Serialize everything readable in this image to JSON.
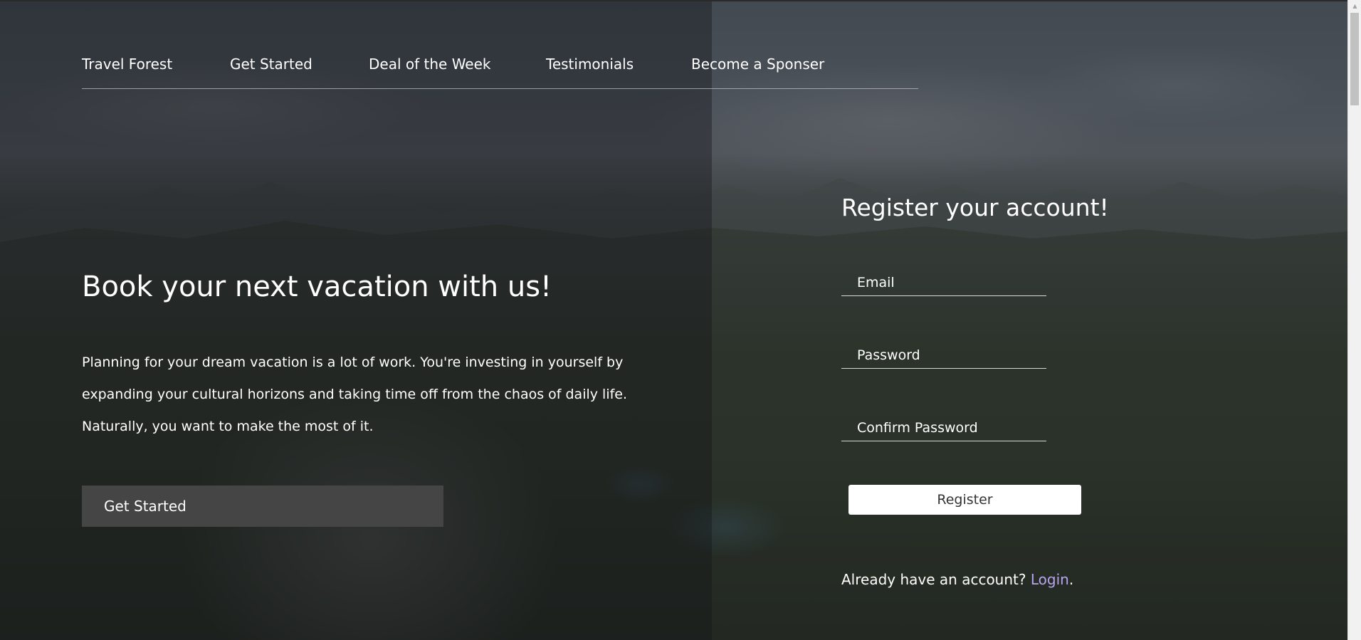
{
  "nav": {
    "items": [
      {
        "label": "Travel Forest"
      },
      {
        "label": "Get Started"
      },
      {
        "label": "Deal of the Week"
      },
      {
        "label": "Testimonials"
      },
      {
        "label": "Become a Sponser"
      }
    ]
  },
  "hero": {
    "title": "Book your next vacation with us!",
    "text": "Planning for your dream vacation is a lot of work. You're investing in yourself by expanding your cultural horizons and taking time off from the chaos of daily life. Naturally, you want to make the most of it.",
    "cta_label": "Get Started"
  },
  "register": {
    "title": "Register your account!",
    "email_placeholder": "Email",
    "password_placeholder": "Password",
    "confirm_placeholder": "Confirm Password",
    "button_label": "Register",
    "login_prompt": "Already have an account? ",
    "login_link": "Login",
    "login_suffix": "."
  },
  "colors": {
    "link": "#b8a4f0",
    "cta_bg": "#454545",
    "register_bg": "#ffffff"
  }
}
